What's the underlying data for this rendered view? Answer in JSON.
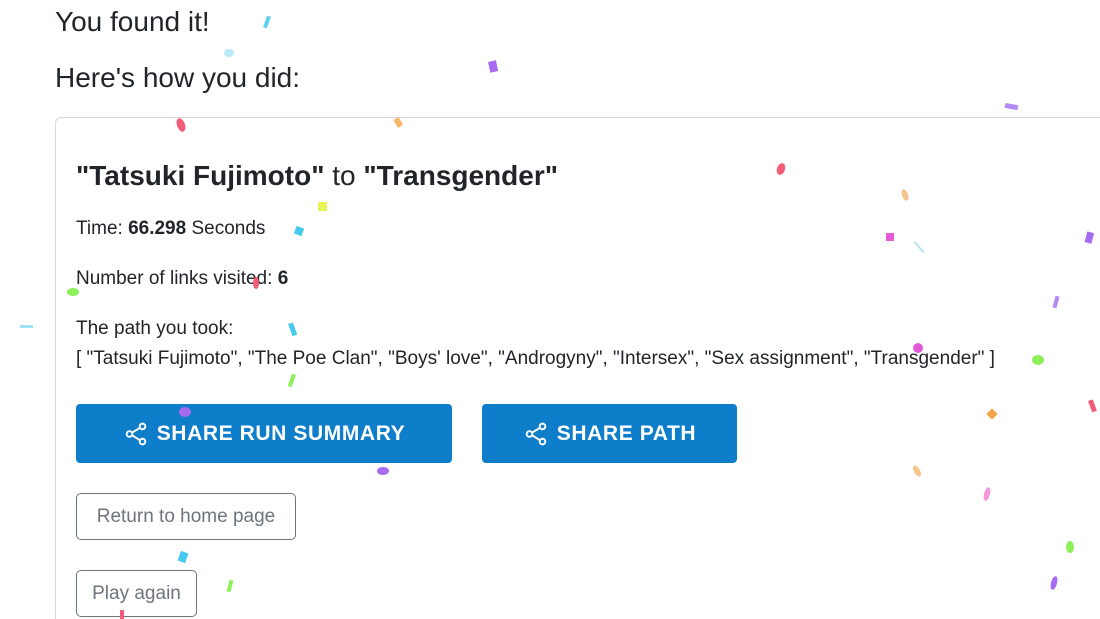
{
  "header": {
    "found": "You found it!",
    "how": "Here's how you did:"
  },
  "result": {
    "start": "\"Tatsuki Fujimoto\"",
    "connector": " to ",
    "end": "\"Transgender\"",
    "time_label": "Time: ",
    "time_value": "66.298",
    "time_unit": " Seconds",
    "links_label": "Number of links visited: ",
    "links_value": "6",
    "path_label": "The path you took:",
    "path_list": "[ \"Tatsuki Fujimoto\", \"The Poe Clan\", \"Boys' love\", \"Androgyny\", \"Intersex\", \"Sex assignment\", \"Transgender\" ]"
  },
  "actions": {
    "share_summary": "SHARE RUN SUMMARY",
    "share_path": "SHARE PATH",
    "share_icon": "share-icon",
    "home": "Return to home page",
    "play_again": "Play again"
  },
  "colors": {
    "primary": "#0e7ecb",
    "secondary": "#6c757d",
    "text": "#212529"
  }
}
